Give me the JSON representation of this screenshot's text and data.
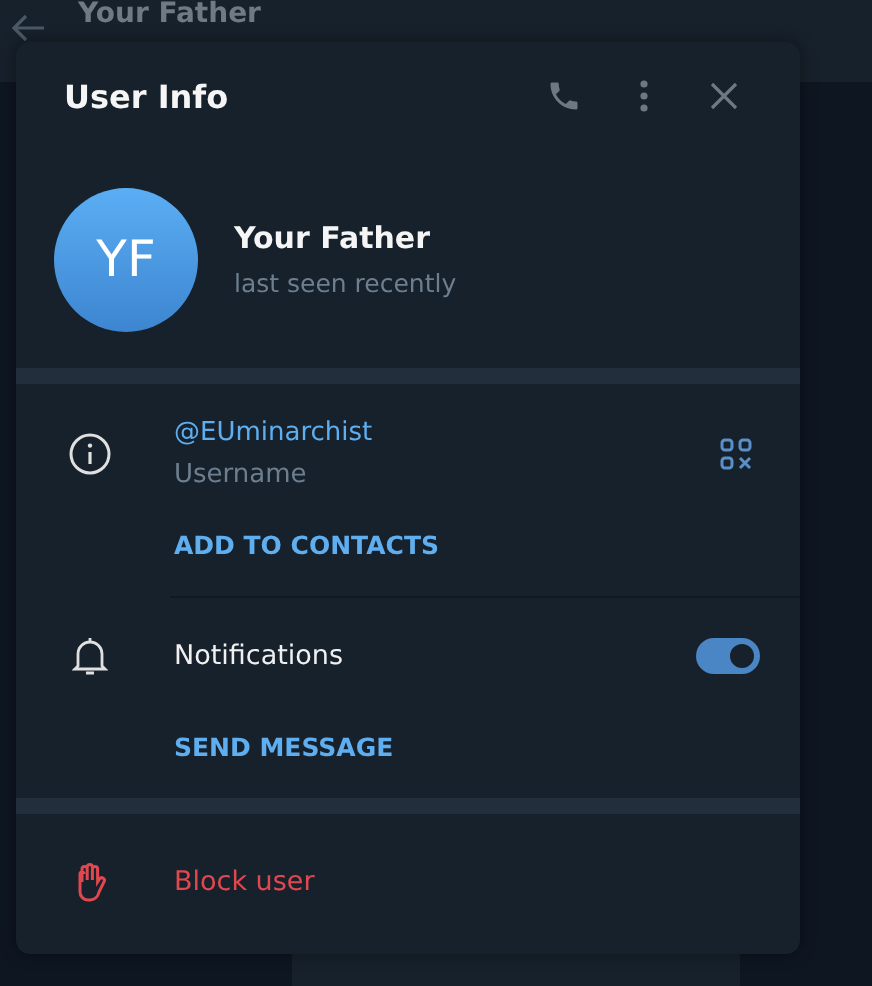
{
  "background_chat": {
    "title": "Your Father"
  },
  "dialog": {
    "title": "User Info",
    "profile": {
      "initials": "YF",
      "name": "Your Father",
      "status": "last seen recently"
    },
    "info": {
      "username": "@EUminarchist",
      "username_label": "Username",
      "add_contact": "ADD TO CONTACTS"
    },
    "notifications": {
      "label": "Notifications",
      "on": true
    },
    "send_message": "SEND MESSAGE",
    "block": "Block user"
  }
}
